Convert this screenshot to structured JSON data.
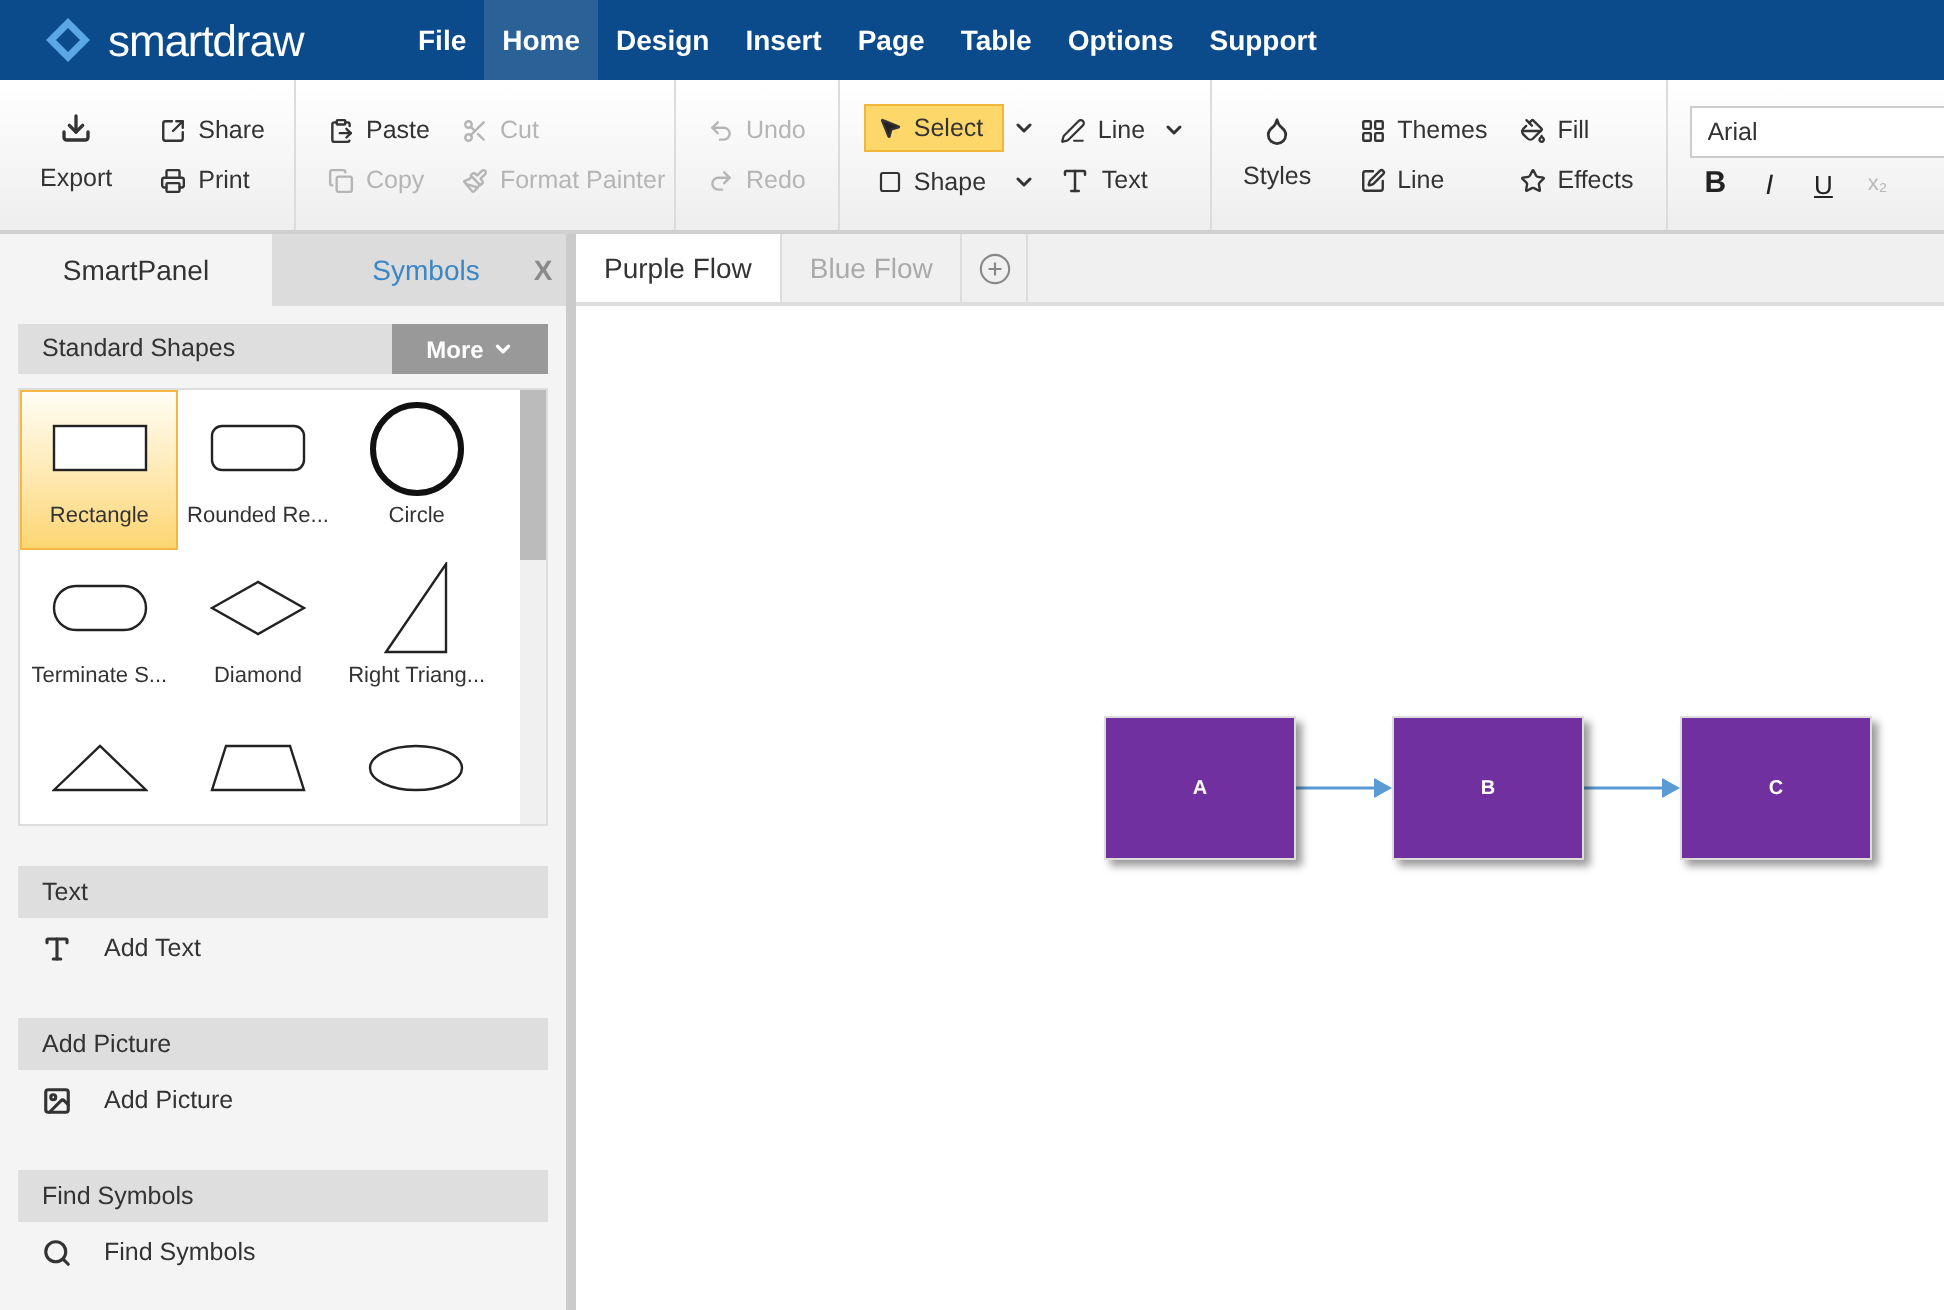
{
  "app": {
    "logo": "smartdraw"
  },
  "menu": [
    {
      "label": "File",
      "selected": false
    },
    {
      "label": "Home",
      "selected": true
    },
    {
      "label": "Design",
      "selected": false
    },
    {
      "label": "Insert",
      "selected": false
    },
    {
      "label": "Page",
      "selected": false
    },
    {
      "label": "Table",
      "selected": false
    },
    {
      "label": "Options",
      "selected": false
    },
    {
      "label": "Support",
      "selected": false
    }
  ],
  "ribbon": {
    "export": {
      "label": "Export"
    },
    "file_group": [
      {
        "label": "Share",
        "disabled": false
      },
      {
        "label": "Print",
        "disabled": false
      }
    ],
    "clipboard": [
      {
        "label": "Paste",
        "disabled": false
      },
      {
        "label": "Cut",
        "disabled": true
      },
      {
        "label": "Copy",
        "disabled": true
      },
      {
        "label": "Format Painter",
        "disabled": true
      }
    ],
    "history": [
      {
        "label": "Undo",
        "disabled": true
      },
      {
        "label": "Redo",
        "disabled": true
      }
    ],
    "tools": [
      {
        "label": "Select",
        "selected": true
      },
      {
        "label": "Shape",
        "selected": false
      }
    ],
    "draw": [
      {
        "label": "Line"
      },
      {
        "label": "Text"
      }
    ],
    "styles": {
      "label": "Styles"
    },
    "style_group": [
      {
        "label": "Themes"
      },
      {
        "label": "Fill"
      },
      {
        "label": "Line"
      },
      {
        "label": "Effects"
      }
    ],
    "font": {
      "value": "Arial"
    },
    "format": [
      {
        "label": "B",
        "disabled": false
      },
      {
        "label": "I",
        "disabled": false
      },
      {
        "label": "U",
        "disabled": false
      },
      {
        "label": "x₂",
        "disabled": true
      }
    ]
  },
  "panel": {
    "tabs": [
      {
        "label": "SmartPanel",
        "selected": true
      },
      {
        "label": "Symbols",
        "selected": false
      }
    ],
    "close": "X",
    "library": {
      "title": "Standard Shapes",
      "more": "More",
      "shapes": [
        {
          "label": "Rectangle",
          "kind": "rectangle",
          "selected": true
        },
        {
          "label": "Rounded Re...",
          "kind": "rounded",
          "selected": false
        },
        {
          "label": "Circle",
          "kind": "circle",
          "selected": false
        },
        {
          "label": "Terminate S...",
          "kind": "terminator",
          "selected": false
        },
        {
          "label": "Diamond",
          "kind": "diamond",
          "selected": false
        },
        {
          "label": "Right Triang...",
          "kind": "right-triangle",
          "selected": false
        },
        {
          "kind": "triangle",
          "selected": false
        },
        {
          "kind": "trapezoid",
          "selected": false
        },
        {
          "kind": "ellipse",
          "selected": false
        }
      ]
    },
    "sections": [
      {
        "title": "Text",
        "item": "Add Text",
        "kind": "text"
      },
      {
        "title": "Add Picture",
        "item": "Add Picture",
        "kind": "picture"
      },
      {
        "title": "Find Symbols",
        "item": "Find Symbols",
        "kind": "search"
      }
    ]
  },
  "documents": [
    {
      "label": "Purple Flow",
      "selected": true
    },
    {
      "label": "Blue Flow",
      "selected": false
    }
  ],
  "diagram": {
    "nodes": [
      {
        "label": "A",
        "color": "#7030a0"
      },
      {
        "label": "B",
        "color": "#7030a0"
      },
      {
        "label": "C",
        "color": "#7030a0"
      }
    ]
  }
}
